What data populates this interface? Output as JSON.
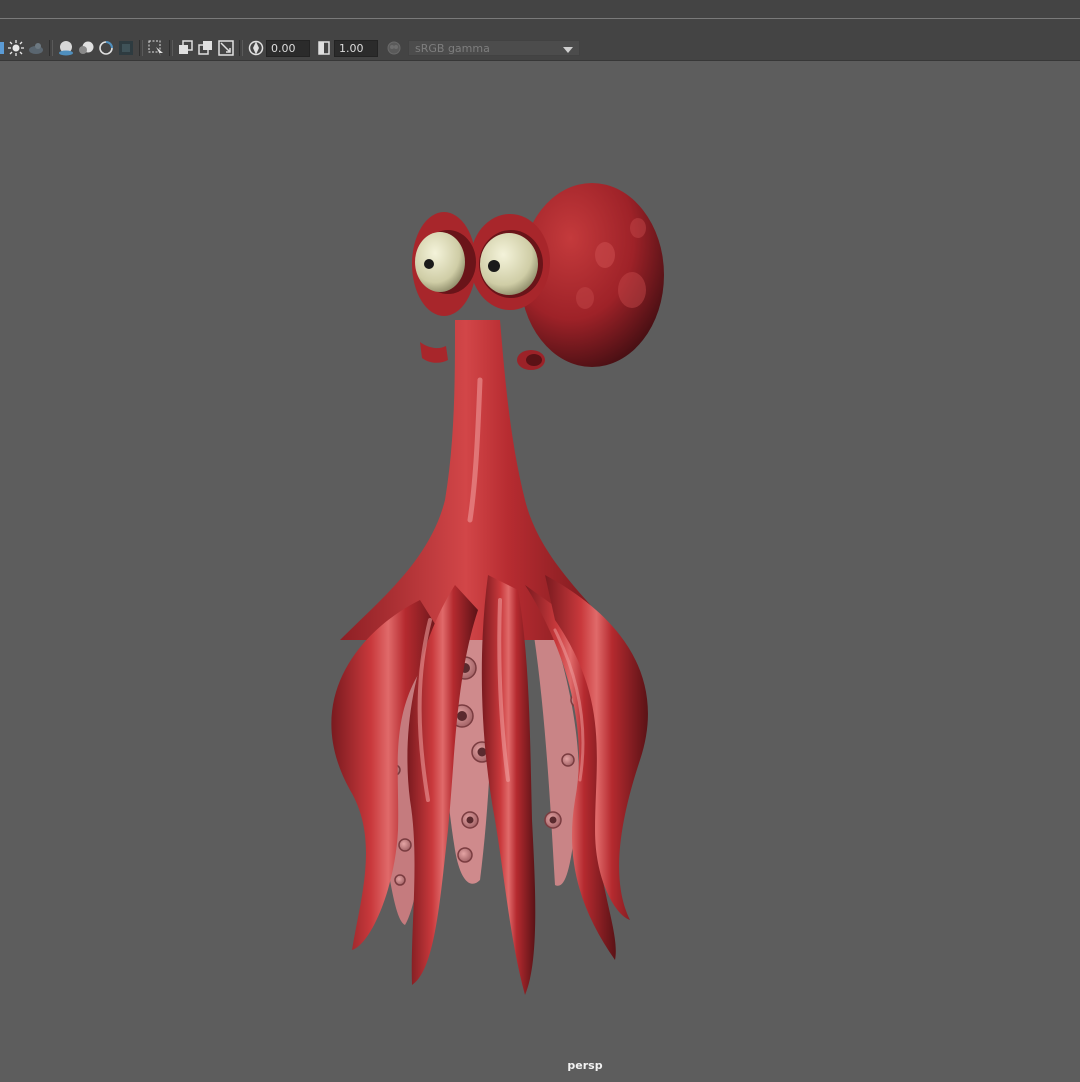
{
  "toolbar": {
    "exposure_value": "0.00",
    "gamma_value": "1.00",
    "color_space": "sRGB gamma",
    "icons": [
      "select-camera-icon",
      "lighting-icon",
      "shadows-icon",
      "ambient-occlusion-icon",
      "motion-blur-icon",
      "antialias-icon",
      "isolate-select-icon",
      "xray-icon",
      "xray-joints-icon",
      "xray-components-icon",
      "resolution-gate-icon",
      "exposure-icon",
      "gamma-icon",
      "color-management-icon",
      "dropdown-arrow-icon"
    ]
  },
  "viewport": {
    "camera": "persp",
    "background": "#5d5d5d",
    "model": "octopus",
    "model_color": "#b3252b"
  }
}
